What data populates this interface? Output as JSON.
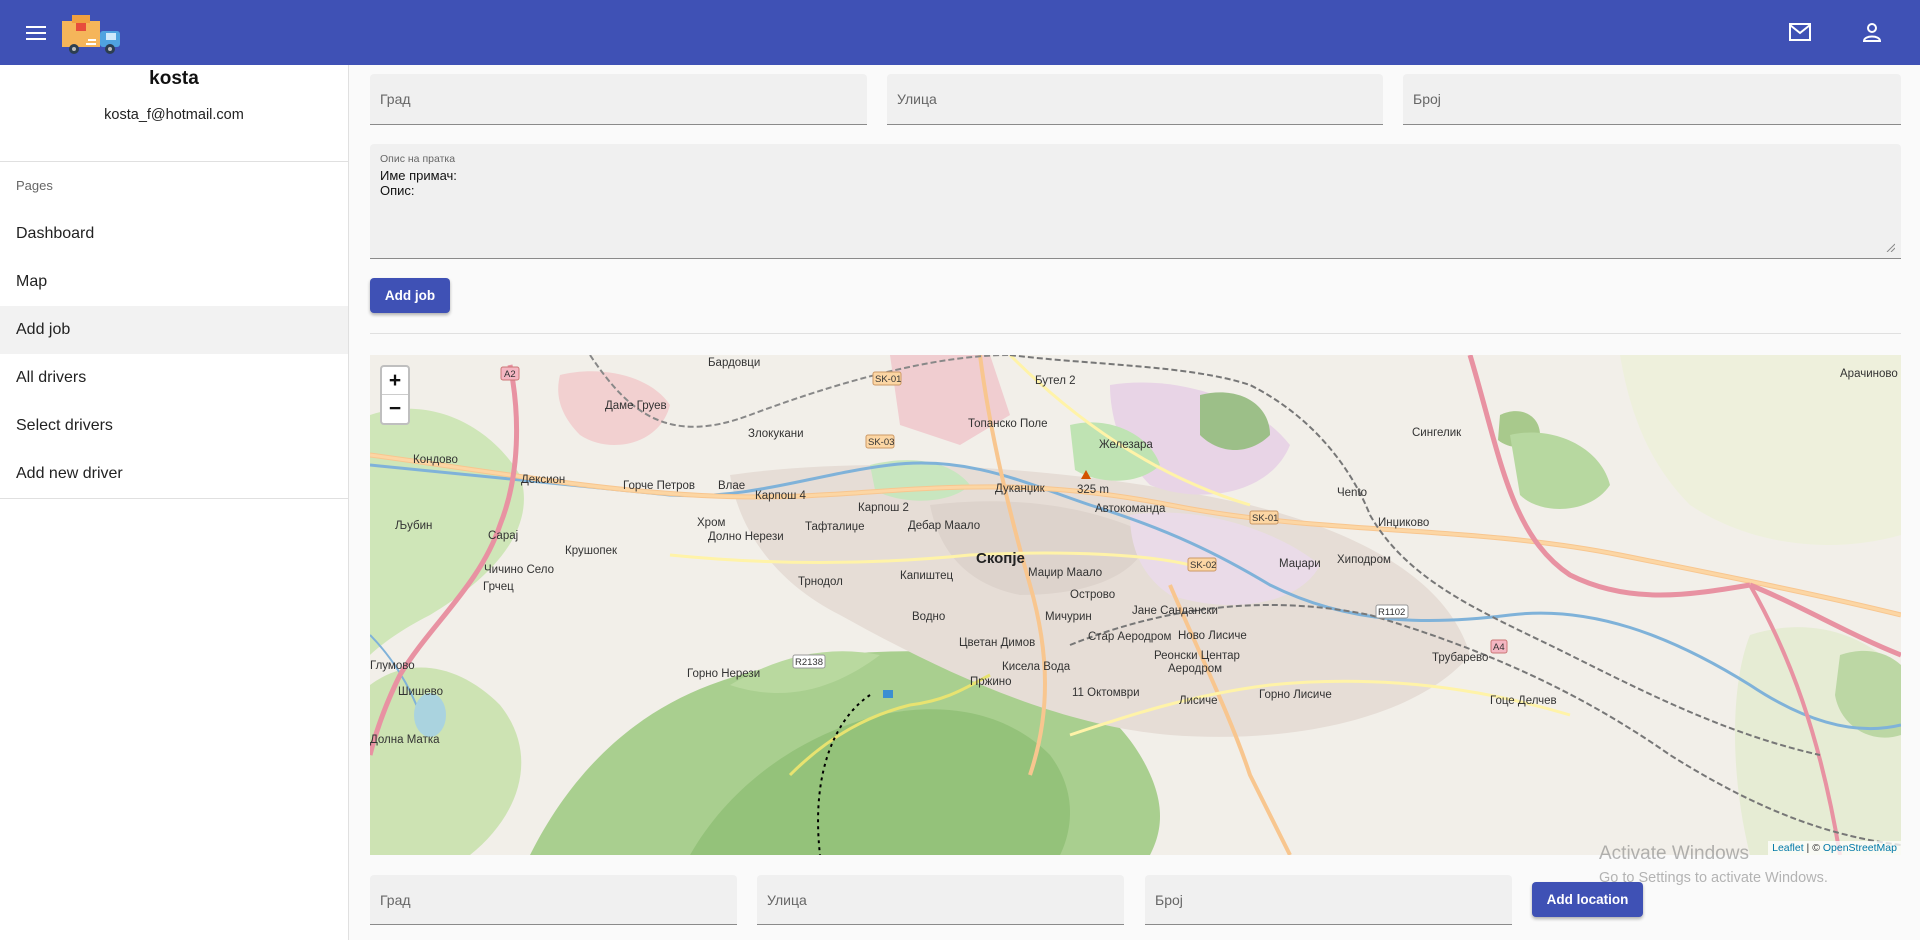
{
  "appbar": {
    "menu_icon": "menu-icon",
    "logo_icon": "delivery-truck-logo",
    "mail_icon": "mail-icon",
    "account_icon": "account-icon",
    "accent": "#3f51b5"
  },
  "user": {
    "name": "kosta",
    "email": "kosta_f@hotmail.com"
  },
  "sidebar": {
    "section_label": "Pages",
    "items": [
      {
        "label": "Dashboard"
      },
      {
        "label": "Map"
      },
      {
        "label": "Add job",
        "active": true
      },
      {
        "label": "All drivers"
      },
      {
        "label": "Select drivers"
      },
      {
        "label": "Add new driver"
      }
    ]
  },
  "job_form": {
    "city_placeholder": "Град",
    "street_placeholder": "Улица",
    "number_placeholder": "Број",
    "description_label": "Опис на пратка",
    "description_value": "Име примач:\nОпис:",
    "add_job_label": "Add job"
  },
  "map": {
    "zoom_in": "+",
    "zoom_out": "−",
    "attribution_leaflet": "Leaflet",
    "attribution_sep": " | © ",
    "attribution_osm": "OpenStreetMap",
    "labels": {
      "bardovci": "Бардовци",
      "dame_gruev": "Даме Груев",
      "butel2": "Бутел 2",
      "topansko": "Топанско Поле",
      "zlokukani": "Злокукани",
      "zhelezara": "Железара",
      "kondovo": "Кондово",
      "dekson": "Дексион",
      "gorche": "Горче Петров",
      "vlae": "Влае",
      "karposh4": "Карпош 4",
      "karposh2": "Карпош 2",
      "dukandzik": "Дуканџик",
      "avtokomanda": "Автокоманда",
      "chento": "Чento",
      "singelik": "Сингелик",
      "lubin": "Љубин",
      "saraj": "Сарај",
      "hrom": "Хром",
      "dolno_nerezi": "Долно Нерези",
      "taftalidze": "Тафталиџе",
      "debar_maalo": "Дебар Маало",
      "skopje": "Скопје",
      "indzikovo": "Инџиково",
      "krushopek": "Крушопек",
      "chichino": "Чичино Село",
      "trnodol": "Трнодол",
      "kapishtec": "Капиштец",
      "madzhir": "Маџир Маало",
      "madzhari": "Маџари",
      "hipodrom": "Хиподром",
      "grchec": "Грчец",
      "vodno": "Водно",
      "ostrovo": "Острово",
      "jane": "Јане Сандански",
      "michurin": "Мичурин",
      "tsvetan": "Цветан Димов",
      "star_aerodrom": "Стар Аеродром",
      "novo_lisiche": "Ново Лисиче",
      "glumovo": "Глумово",
      "gorno_nerezi": "Горно Нерези",
      "kisela_voda": "Кисела Вода",
      "reonski": "Реонски Центар",
      "aerodrom": "Аеродром",
      "trubarevo": "Трубарево",
      "shishevo": "Шишево",
      "przhino": "Пржино",
      "oktomvri": "11 Октомври",
      "lisiche": "Лисиче",
      "gorno_lisiche": "Горно Лисиче",
      "goce": "Гоце Делчев",
      "dolna_matka": "Долна Матка",
      "arachinovo": "Арачиново",
      "elevation": "325 m"
    }
  },
  "location_form": {
    "city_placeholder": "Град",
    "street_placeholder": "Улица",
    "number_placeholder": "Број",
    "add_location_label": "Add location"
  },
  "watermark": {
    "line1": "Activate Windows",
    "line2": "Go to Settings to activate Windows."
  }
}
